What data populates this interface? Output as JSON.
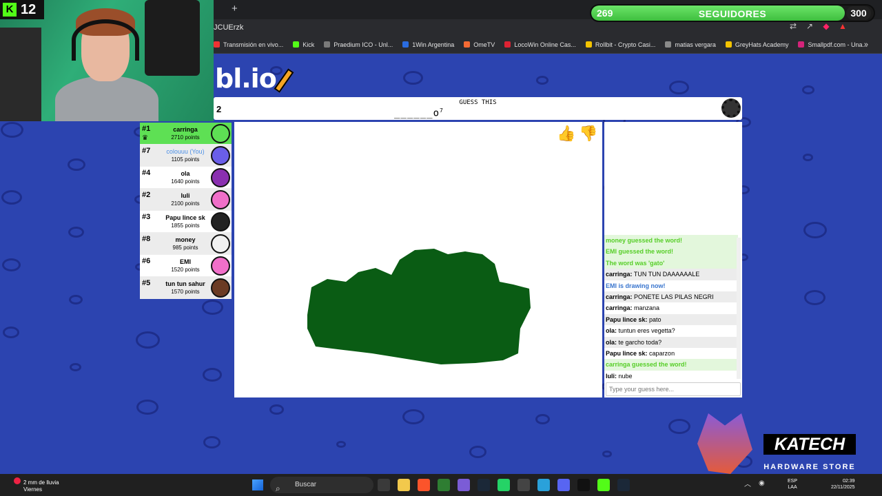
{
  "stream": {
    "kick_viewers": "12",
    "followers": {
      "current": "269",
      "label": "SEGUIDORES",
      "goal": "300",
      "progress": 0.897
    }
  },
  "browser": {
    "new_tab": "+",
    "url": "JCUErzk",
    "bookmarks": [
      {
        "label": "Transmisión en vivo...",
        "color": "#e33"
      },
      {
        "label": "Kick",
        "color": "#53fc18"
      },
      {
        "label": "Praedium ICO - Unl...",
        "color": "#7a7a7a"
      },
      {
        "label": "1Win Argentina",
        "color": "#2a6ce0"
      },
      {
        "label": "OmeTV",
        "color": "#f46a34"
      },
      {
        "label": "LocoWin Online Cas...",
        "color": "#d23"
      },
      {
        "label": "Rollbit - Crypto Casi...",
        "color": "#f3c300"
      },
      {
        "label": "matias vergara",
        "color": "#8a8a8a"
      },
      {
        "label": "GreyHats Academy",
        "color": "#f3c300"
      },
      {
        "label": "Smallpdf.com - Una...",
        "color": "#d4237a"
      }
    ],
    "more": "»"
  },
  "game": {
    "logo": "bl.io",
    "round": "2",
    "heading": "GUESS THIS",
    "hint": "______o",
    "hint_count": "7",
    "players": [
      {
        "rank": "#1",
        "name": "carringa",
        "points": "2710 points",
        "avatar": "#5ee054",
        "winner": true
      },
      {
        "rank": "#7",
        "name": "colouuu (You)",
        "points": "1105 points",
        "avatar": "#6a5ee8",
        "me": true
      },
      {
        "rank": "#4",
        "name": "ola",
        "points": "1640 points",
        "avatar": "#8a2fb0"
      },
      {
        "rank": "#2",
        "name": "luli",
        "points": "2100 points",
        "avatar": "#f06fc9"
      },
      {
        "rank": "#3",
        "name": "Papu lince sk",
        "points": "1855 points",
        "avatar": "#222222"
      },
      {
        "rank": "#8",
        "name": "money",
        "points": "985 points",
        "avatar": "#f1f1f1"
      },
      {
        "rank": "#6",
        "name": "EMI",
        "points": "1520 points",
        "avatar": "#f06fc9"
      },
      {
        "rank": "#5",
        "name": "tun tun sahur",
        "points": "1570 points",
        "avatar": "#6b3b24"
      }
    ],
    "bubbles": [
      {
        "text": "nube"
      },
      {
        "text": "caparzon"
      }
    ],
    "drawing_color": "#0a5c14",
    "chat": [
      {
        "type": "green",
        "text": "money guessed the word!"
      },
      {
        "type": "green",
        "text": "EMI guessed the word!"
      },
      {
        "type": "green",
        "text": "The word was 'gato'"
      },
      {
        "type": "msg",
        "user": "carringa:",
        "text": "TUN TUN DAAAAAALE"
      },
      {
        "type": "blue",
        "text": "EMI is drawing now!"
      },
      {
        "type": "msg",
        "user": "carringa:",
        "text": "PONETE LAS PILAS NEGRI"
      },
      {
        "type": "msg",
        "user": "carringa:",
        "text": "manzana"
      },
      {
        "type": "msg",
        "user": "Papu lince sk:",
        "text": "pato"
      },
      {
        "type": "msg",
        "user": "ola:",
        "text": "tuntun eres vegetta?"
      },
      {
        "type": "msg",
        "user": "ola:",
        "text": "te garcho toda?"
      },
      {
        "type": "msg",
        "user": "Papu lince sk:",
        "text": "caparzon"
      },
      {
        "type": "green",
        "text": "carringa guessed the word!"
      },
      {
        "type": "msg",
        "user": "luli:",
        "text": "nube"
      }
    ],
    "chat_placeholder": "Type your guess here..."
  },
  "sponsor": {
    "brand": "KATECH",
    "sub": "HARDWARE STORE"
  },
  "taskbar": {
    "weather_line1": "2 mm de lluvia",
    "weather_line2": "Viernes",
    "search": "Buscar",
    "lang1": "ESP",
    "lang2": "LAA",
    "time": "02:39",
    "date": "22/11/2025"
  }
}
